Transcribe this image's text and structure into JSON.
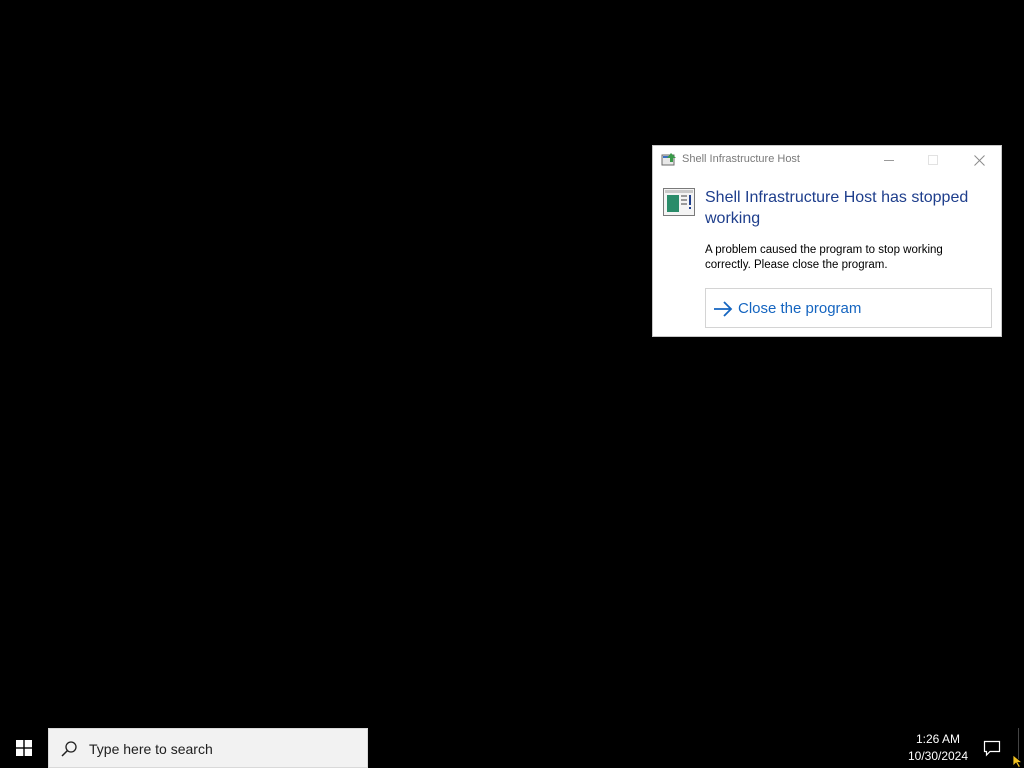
{
  "dialog": {
    "window_title": "Shell Infrastructure Host",
    "heading": "Shell Infrastructure Host has stopped working",
    "body": "A problem caused the program to stop working correctly. Please close the program.",
    "command_link": "Close the program",
    "icons": {
      "app": "app-window-icon",
      "minimize": "minimize-icon",
      "maximize": "maximize-icon",
      "close": "close-icon",
      "program": "program-window-icon",
      "arrow": "arrow-right-icon"
    }
  },
  "taskbar": {
    "search_placeholder": "Type here to search",
    "time": "1:26 AM",
    "date": "10/30/2024",
    "icons": {
      "start": "windows-logo-icon",
      "search": "search-icon",
      "notifications": "action-center-icon"
    }
  },
  "colors": {
    "desktop": "#000000",
    "heading": "#1e3e8c",
    "link": "#1565c0",
    "accent_icon": "#2a8c6a"
  }
}
